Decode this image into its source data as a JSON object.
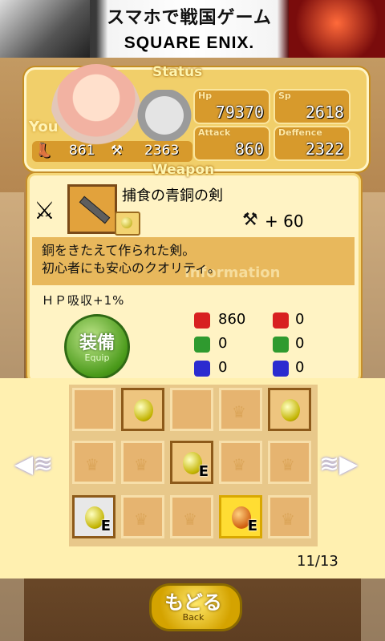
{
  "ad": {
    "title": "スマホで戦国ゲーム",
    "brand": "SQUARE ENIX."
  },
  "status": {
    "header": "Status",
    "you_label": "You",
    "hp_label": "Hp",
    "hp": "79370",
    "sp_label": "Sp",
    "sp": "2618",
    "attack_label": "Attack",
    "attack": "860",
    "defence_label": "Deffence",
    "defence": "2322",
    "mini_left": "861",
    "mini_right": "2363"
  },
  "weapon": {
    "header": "Weapon",
    "name": "捕食の青銅の剣",
    "attack_bonus": "+ 60",
    "description": "銅をきたえて作られた剣。\n初心者にも安心のクオリティ。",
    "info_watermark": "Information",
    "skill": "ＨＰ吸収+1%",
    "equip_main": "装備",
    "equip_sub": "Equip",
    "elements": [
      {
        "atk": "860",
        "def": "0",
        "color": "#d82020"
      },
      {
        "atk": "0",
        "def": "0",
        "color": "#2f9a2f"
      },
      {
        "atk": "0",
        "def": "0",
        "color": "#2b2bd0"
      }
    ]
  },
  "inventory": {
    "page": "11/13",
    "e_mark": "E"
  },
  "back": {
    "main": "もどる",
    "sub": "Back"
  }
}
